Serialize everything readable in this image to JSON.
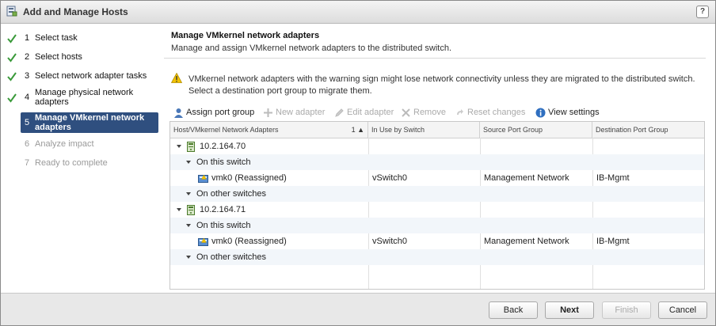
{
  "window": {
    "title": "Add and Manage Hosts",
    "help_label": "?"
  },
  "steps": [
    {
      "num": "1",
      "label": "Select task",
      "state": "done"
    },
    {
      "num": "2",
      "label": "Select hosts",
      "state": "done"
    },
    {
      "num": "3",
      "label": "Select network adapter tasks",
      "state": "done"
    },
    {
      "num": "4",
      "label": "Manage physical network adapters",
      "state": "done"
    },
    {
      "num": "5",
      "label": "Manage VMkernel network adapters",
      "state": "active"
    },
    {
      "num": "6",
      "label": "Analyze impact",
      "state": "future"
    },
    {
      "num": "7",
      "label": "Ready to complete",
      "state": "future"
    }
  ],
  "page": {
    "title": "Manage VMkernel network adapters",
    "subtitle": "Manage and assign VMkernel network adapters to the distributed switch."
  },
  "warning": {
    "icon": "warning-triangle-icon",
    "text": "VMkernel network adapters with the warning sign might lose network connectivity unless they are migrated to the distributed switch. Select a destination port group to migrate them."
  },
  "toolbar": {
    "assign_port_group": "Assign port group",
    "new_adapter": "New adapter",
    "edit_adapter": "Edit adapter",
    "remove": "Remove",
    "reset_changes": "Reset changes",
    "view_settings": "View settings"
  },
  "table": {
    "columns": [
      "Host/VMkernel Network Adapters",
      "In Use by Switch",
      "Source Port Group",
      "Destination Port Group"
    ],
    "sort_indicator": "1 ▲",
    "rows": [
      {
        "type": "host",
        "name": "10.2.164.70"
      },
      {
        "type": "group",
        "name": "On this switch"
      },
      {
        "type": "adapter",
        "name": "vmk0 (Reassigned)",
        "switch": "vSwitch0",
        "source": "Management Network",
        "destination": "IB-Mgmt"
      },
      {
        "type": "group",
        "name": "On other switches"
      },
      {
        "type": "host",
        "name": "10.2.164.71"
      },
      {
        "type": "group",
        "name": "On this switch"
      },
      {
        "type": "adapter",
        "name": "vmk0 (Reassigned)",
        "switch": "vSwitch0",
        "source": "Management Network",
        "destination": "IB-Mgmt"
      },
      {
        "type": "group",
        "name": "On other switches"
      }
    ]
  },
  "footer": {
    "back": "Back",
    "next": "Next",
    "finish": "Finish",
    "cancel": "Cancel"
  }
}
